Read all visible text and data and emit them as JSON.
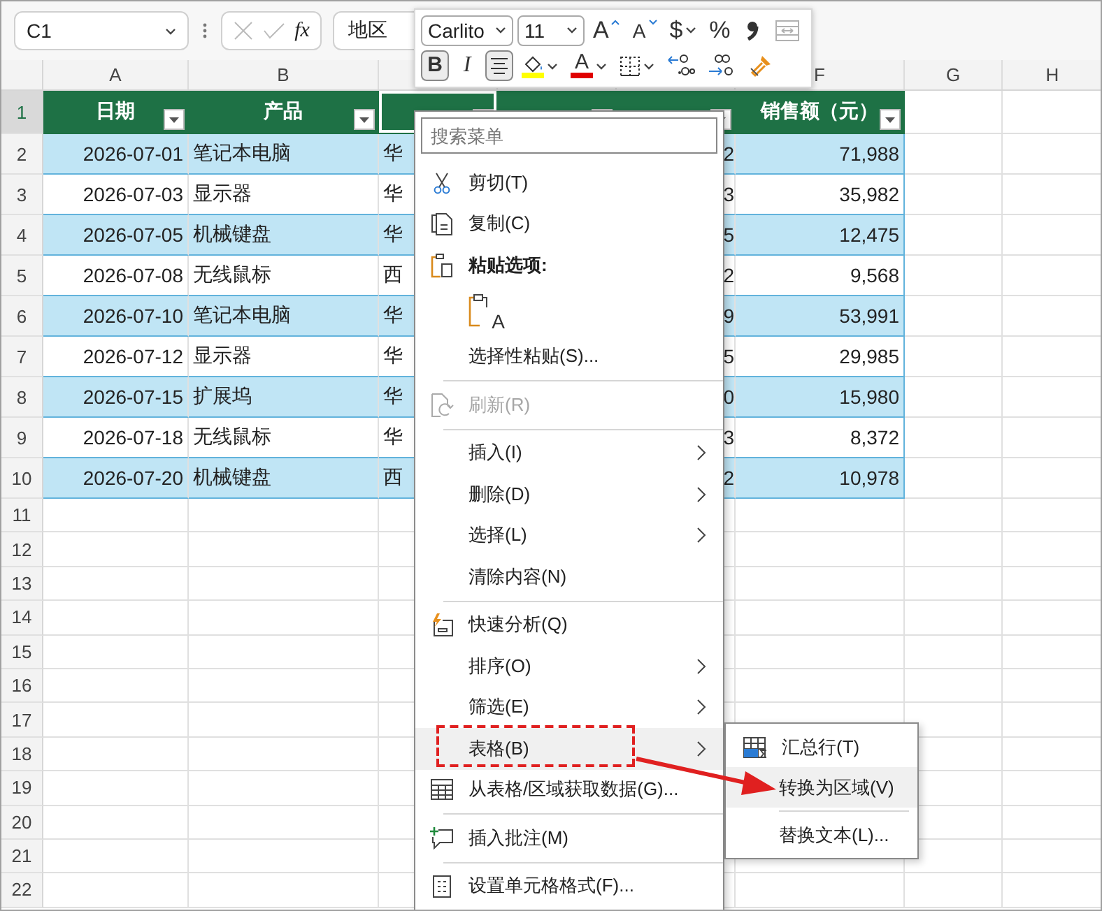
{
  "formula_bar": {
    "cell": "C1",
    "function_label": "fx",
    "value": "地区"
  },
  "columns": [
    "A",
    "B",
    null,
    null,
    null,
    "F",
    "G",
    "H"
  ],
  "row_headers": [
    {
      "label": "1",
      "selected": true
    },
    {
      "label": "2",
      "selected": false
    },
    {
      "label": "3",
      "selected": false
    },
    {
      "label": "4",
      "selected": false
    },
    {
      "label": "5",
      "selected": false
    },
    {
      "label": "6",
      "selected": false
    },
    {
      "label": "7",
      "selected": false
    },
    {
      "label": "8",
      "selected": false
    },
    {
      "label": "9",
      "selected": false
    },
    {
      "label": "10",
      "selected": false
    },
    {
      "label": "11",
      "selected": false
    },
    {
      "label": "12",
      "selected": false
    },
    {
      "label": "13",
      "selected": false
    },
    {
      "label": "14",
      "selected": false
    },
    {
      "label": "15",
      "selected": false
    },
    {
      "label": "16",
      "selected": false
    },
    {
      "label": "17",
      "selected": false
    },
    {
      "label": "18",
      "selected": false
    },
    {
      "label": "19",
      "selected": false
    },
    {
      "label": "20",
      "selected": false
    },
    {
      "label": "21",
      "selected": false
    },
    {
      "label": "22",
      "selected": false
    }
  ],
  "table": {
    "headers": [
      {
        "title": "日期",
        "has_filter": true
      },
      {
        "title": "产品",
        "has_filter": true
      },
      {
        "has_filter": true
      },
      {
        "has_filter": true
      },
      {
        "has_filter": true
      },
      {
        "title": "销售额（元）",
        "has_filter": true
      }
    ],
    "rows": [
      {
        "date": "2026-07-01",
        "product": "笔记本电脑",
        "region": "华",
        "quantity": "2",
        "amount": "71,988"
      },
      {
        "date": "2026-07-03",
        "product": "显示器",
        "region": "华",
        "quantity": "3",
        "amount": "35,982"
      },
      {
        "date": "2026-07-05",
        "product": "机械键盘",
        "region": "华",
        "quantity": "5",
        "amount": "12,475"
      },
      {
        "date": "2026-07-08",
        "product": "无线鼠标",
        "region": "西",
        "quantity": "2",
        "amount": "9,568"
      },
      {
        "date": "2026-07-10",
        "product": "笔记本电脑",
        "region": "华",
        "quantity": "9",
        "amount": "53,991"
      },
      {
        "date": "2026-07-12",
        "product": "显示器",
        "region": "华",
        "quantity": "5",
        "amount": "29,985"
      },
      {
        "date": "2026-07-15",
        "product": "扩展坞",
        "region": "华",
        "quantity": "0",
        "amount": "15,980"
      },
      {
        "date": "2026-07-18",
        "product": "无线鼠标",
        "region": "华",
        "quantity": "3",
        "amount": "8,372"
      },
      {
        "date": "2026-07-20",
        "product": "机械键盘",
        "region": "西",
        "quantity": "2",
        "amount": "10,978"
      }
    ]
  },
  "mini_toolbar": {
    "font": "Carlito",
    "size": "11",
    "row1": [
      {
        "kind": "grow",
        "label": "A",
        "pressed": false,
        "disabled": false
      },
      {
        "kind": "shrink",
        "label": "A",
        "pressed": false,
        "disabled": false
      },
      {
        "kind": "currency",
        "label": "$",
        "pressed": false,
        "disabled": false
      },
      {
        "kind": "percent",
        "label": "%",
        "pressed": false,
        "disabled": false
      },
      {
        "kind": "comma",
        "pressed": false,
        "disabled": false
      },
      {
        "kind": "merge",
        "pressed": false,
        "disabled": true
      }
    ],
    "row2": [
      {
        "kind": "bold",
        "label": "B",
        "pressed": true,
        "disabled": false
      },
      {
        "kind": "italic",
        "label": "I",
        "pressed": false,
        "disabled": false
      },
      {
        "kind": "align",
        "pressed": true,
        "disabled": false
      },
      {
        "kind": "fill",
        "color": "#ffff00",
        "pressed": false,
        "disabled": false
      },
      {
        "kind": "font-color",
        "label": "A",
        "color": "#e00000",
        "pressed": false,
        "disabled": false
      },
      {
        "kind": "borders",
        "pressed": false,
        "disabled": false
      },
      {
        "kind": "increase-decimals",
        "pressed": false,
        "disabled": false
      },
      {
        "kind": "decrease-decimals",
        "pressed": false,
        "disabled": false
      },
      {
        "kind": "format-painter",
        "pressed": false,
        "disabled": false
      }
    ]
  },
  "context_menu": {
    "search": {
      "placeholder": "搜索菜单"
    },
    "items": [
      {
        "kind": "cut",
        "label": "剪切(T)",
        "has_submenu": false,
        "highlighted": false,
        "disabled": false
      },
      {
        "kind": "copy",
        "label": "复制(C)",
        "has_submenu": false,
        "highlighted": false,
        "disabled": false
      },
      {
        "kind": "paste-heading",
        "label": "粘贴选项:",
        "has_submenu": false,
        "highlighted": false,
        "disabled": false
      },
      {
        "kind": "paste-option",
        "label": "A"
      },
      {
        "kind": "plain",
        "label": "选择性粘贴(S)...",
        "has_submenu": false,
        "highlighted": false,
        "disabled": false
      },
      {
        "kind": "separator"
      },
      {
        "kind": "refresh",
        "label": "刷新(R)",
        "has_submenu": false,
        "highlighted": false,
        "disabled": true
      },
      {
        "kind": "separator"
      },
      {
        "kind": "plain",
        "label": "插入(I)",
        "has_submenu": true,
        "highlighted": false,
        "disabled": false
      },
      {
        "kind": "plain",
        "label": "删除(D)",
        "has_submenu": true,
        "highlighted": false,
        "disabled": false
      },
      {
        "kind": "plain",
        "label": "选择(L)",
        "has_submenu": true,
        "highlighted": false,
        "disabled": false
      },
      {
        "kind": "plain",
        "label": "清除内容(N)",
        "has_submenu": false,
        "highlighted": false,
        "disabled": false
      },
      {
        "kind": "separator"
      },
      {
        "kind": "quick-analysis",
        "label": "快速分析(Q)",
        "has_submenu": false,
        "highlighted": false,
        "disabled": false
      },
      {
        "kind": "plain",
        "label": "排序(O)",
        "has_submenu": true,
        "highlighted": false,
        "disabled": false
      },
      {
        "kind": "plain",
        "label": "筛选(E)",
        "has_submenu": true,
        "highlighted": false,
        "disabled": false
      },
      {
        "kind": "plain",
        "label": "表格(B)",
        "has_submenu": true,
        "highlighted": true,
        "disabled": false
      },
      {
        "kind": "get-data",
        "label": "从表格/区域获取数据(G)...",
        "has_submenu": false,
        "highlighted": false,
        "disabled": false
      },
      {
        "kind": "separator"
      },
      {
        "kind": "comment",
        "label": "插入批注(M)",
        "has_submenu": false,
        "highlighted": false,
        "disabled": false
      },
      {
        "kind": "separator"
      },
      {
        "kind": "format-cells",
        "label": "设置单元格格式(F)...",
        "has_submenu": false,
        "highlighted": false,
        "disabled": false
      }
    ]
  },
  "submenu": {
    "items": [
      {
        "kind": "total-row",
        "label": "汇总行(T)",
        "highlighted": false
      },
      {
        "kind": "plain",
        "label": "转换为区域(V)",
        "highlighted": true
      },
      {
        "kind": "separator"
      },
      {
        "kind": "plain",
        "label": "替换文本(L)...",
        "highlighted": false
      }
    ]
  },
  "annotations": {
    "dashed_frame": true,
    "arrow": true
  }
}
